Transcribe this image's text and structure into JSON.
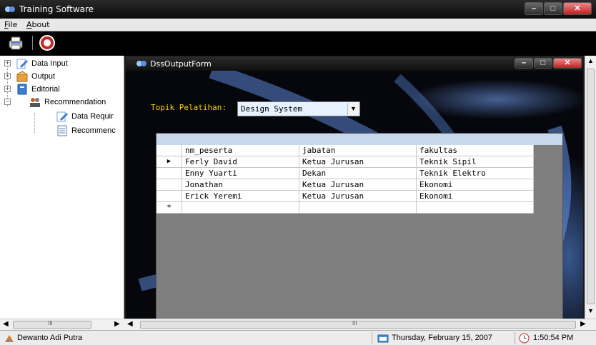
{
  "app": {
    "title": "Training Software"
  },
  "menu": {
    "file": {
      "first": "F",
      "rest": "ile"
    },
    "about": {
      "first": "A",
      "rest": "bout"
    }
  },
  "toolbar": {
    "icons": [
      "printer-icon",
      "help-icon"
    ]
  },
  "tree": {
    "items": [
      {
        "label": "Data Input",
        "icon": "pencil-icon"
      },
      {
        "label": "Output",
        "icon": "box-icon"
      },
      {
        "label": "Editorial",
        "icon": "book-icon"
      },
      {
        "label": "Recommendation",
        "icon": "people-icon"
      },
      {
        "label": "Data Requir",
        "icon": "pencil-icon"
      },
      {
        "label": "Recommenc",
        "icon": "document-icon"
      }
    ]
  },
  "child": {
    "title": "DssOutputForm",
    "topik_label": "Topik Pelatihan:",
    "topik_value": "Design System"
  },
  "grid": {
    "columns": [
      "nm_peserta",
      "jabatan",
      "fakultas"
    ],
    "rows": [
      [
        "Ferly David",
        "Ketua Jurusan",
        "Teknik Sipil"
      ],
      [
        "Enny Yuarti",
        "Dekan",
        "Teknik Elektro"
      ],
      [
        "Jonathan",
        "Ketua Jurusan",
        "Ekonomi"
      ],
      [
        "Erick Yeremi",
        "Ketua Jurusan",
        "Ekonomi"
      ]
    ],
    "current_row_marker": "▶",
    "new_row_marker": "*"
  },
  "status": {
    "user": "Dewanto Adi Putra",
    "date": "Thursday, February 15, 2007",
    "time": "1:50:54 PM"
  },
  "scroll": {
    "grip": "III"
  }
}
